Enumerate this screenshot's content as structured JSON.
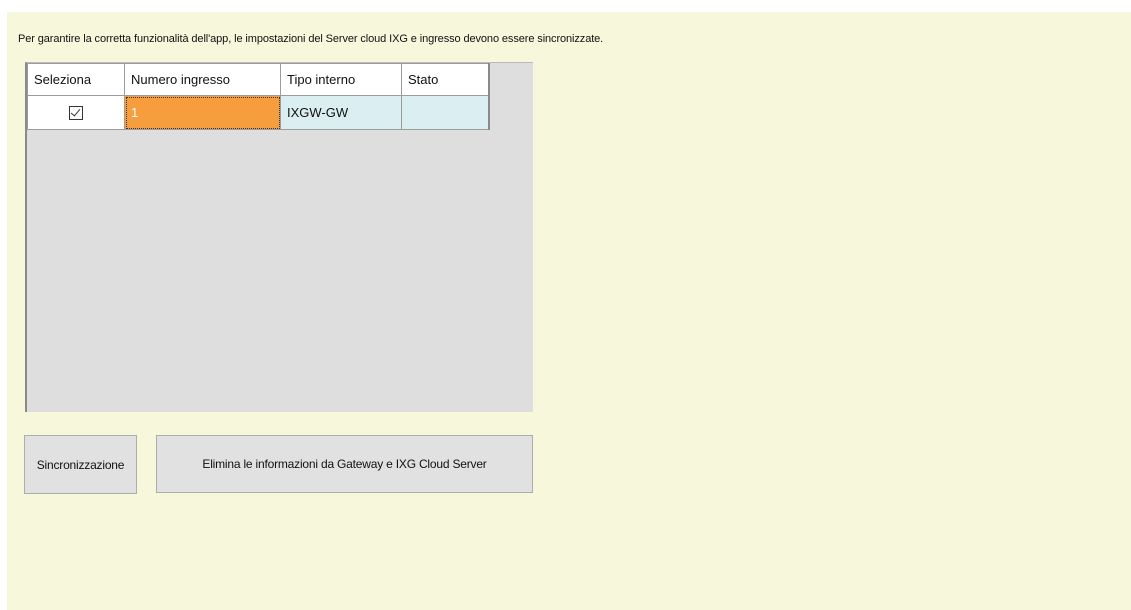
{
  "info_text": "Per garantire la corretta funzionalità dell'app, le impostazioni del Server cloud IXG e ingresso devono essere sincronizzate.",
  "table": {
    "columns": [
      "Seleziona",
      "Numero ingresso",
      "Tipo interno",
      "Stato"
    ],
    "rows": [
      {
        "selected": true,
        "numero_ingresso": "1",
        "tipo_interno": "IXGW-GW",
        "stato": ""
      }
    ]
  },
  "buttons": {
    "sync_label": "Sincronizzazione",
    "delete_label": "Elimina le informazioni da Gateway e IXG Cloud Server"
  },
  "colors": {
    "panel_bg": "#f7f7dc",
    "row_bg": "#dbeff3",
    "selected_cell": "#f69d3d",
    "grid_bg": "#dedede"
  }
}
